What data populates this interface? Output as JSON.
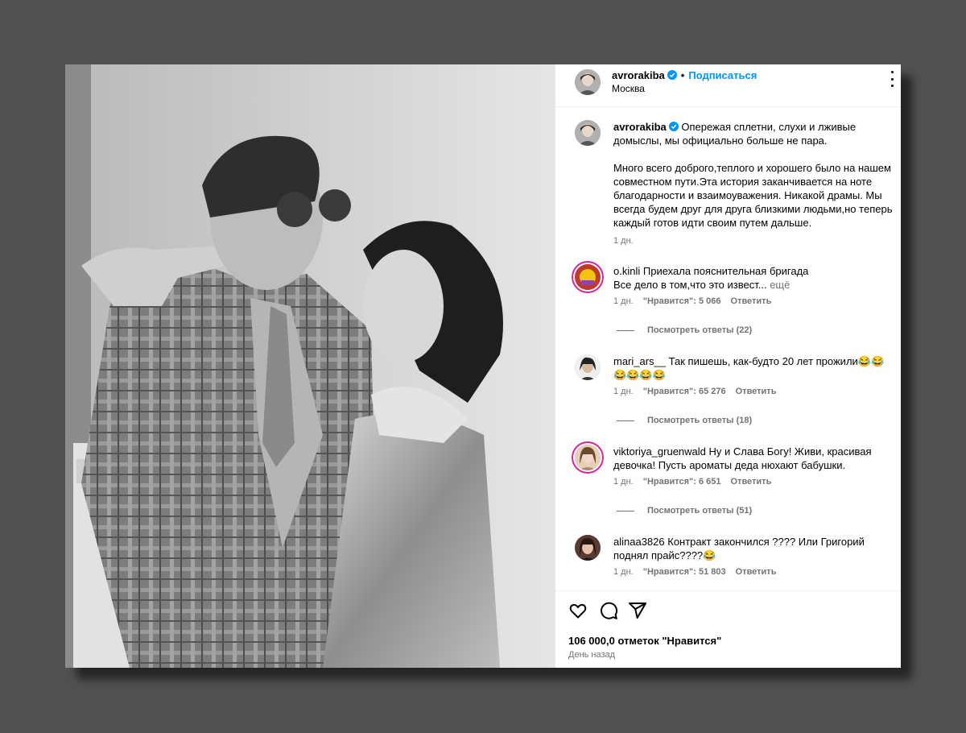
{
  "post": {
    "username": "avrorakiba",
    "dot": "•",
    "follow_label": "Подписаться",
    "location": "Москва",
    "caption": "Опережая сплетни, слухи и лживые домыслы, мы официально больше не пара.\n\nМного всего доброго,теплого и хорошего было на нашем совместном пути.Эта история заканчивается на ноте благодарности и взаимоуважения. Никакой драмы. Мы всегда будем друг для друга близкими людьми,но теперь каждый готов идти своим путем дальше.",
    "caption_time": "1 дн."
  },
  "comments": [
    {
      "username": "o.kinli",
      "text": "Приехала пояснительная бригада\nВсе дело в том,что это извест...",
      "more_label": "ещё",
      "time": "1 дн.",
      "likes": "\"Нравится\": 5 066",
      "reply_label": "Ответить",
      "replies_label": "Посмотреть ответы (22)"
    },
    {
      "username": "mari_ars__",
      "text": "Так пишешь, как-будто 20 лет прожили😂😂😂😂😂😂",
      "time": "1 дн.",
      "likes": "\"Нравится\": 65 276",
      "reply_label": "Ответить",
      "replies_label": "Посмотреть ответы (18)"
    },
    {
      "username": "viktoriya_gruenwald",
      "text": "Ну и Слава Богу! Живи, красивая девочка! Пусть ароматы деда нюхают бабушки.",
      "time": "1 дн.",
      "likes": "\"Нравится\": 6 651",
      "reply_label": "Ответить",
      "replies_label": "Посмотреть ответы (51)"
    },
    {
      "username": "alinaa3826",
      "text": "Контракт закончился ???? Или Григорий поднял прайс????😂",
      "time": "1 дн.",
      "likes": "\"Нравится\": 51 803",
      "reply_label": "Ответить"
    }
  ],
  "footer": {
    "likes": "106 000,0 отметок \"Нравится\"",
    "time": "День назад"
  },
  "icons": [
    "more-icon",
    "verified-icon",
    "heart-icon",
    "comment-icon",
    "share-icon"
  ],
  "colors": {
    "accent": "#0095f6",
    "muted": "#737373",
    "background": "#515151"
  }
}
